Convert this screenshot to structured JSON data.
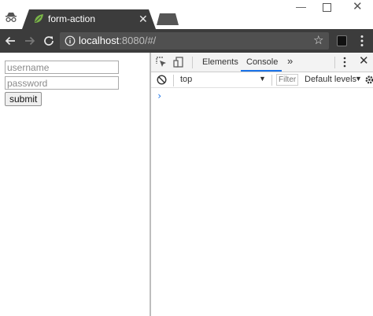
{
  "browser": {
    "tab": {
      "title": "form-action"
    },
    "address_bar": {
      "host": "localhost",
      "rest": ":8080/#/"
    }
  },
  "page": {
    "username_placeholder": "username",
    "password_placeholder": "password",
    "submit_label": "submit"
  },
  "devtools": {
    "tabs": [
      "Elements",
      "Console"
    ],
    "more_tabs": "»",
    "active_tab": "Console",
    "context": "top",
    "filter_placeholder": "Filter",
    "levels": "Default levels",
    "prompt": "›"
  },
  "colors": {
    "chrome_dark": "#3c3c3c",
    "omnibox": "#505050",
    "accent": "#1a73e8",
    "favicon": "#7ab648"
  },
  "icons": {
    "incognito": "incognito-icon",
    "favicon": "leaf-icon",
    "back": "arrow-left-icon",
    "forward": "arrow-right-icon",
    "reload": "reload-icon",
    "info": "info-icon",
    "bookmark": "star-icon",
    "extension": "extension-icon",
    "menu": "kebab-menu-icon",
    "inspect": "inspect-element-icon",
    "device": "device-toolbar-icon",
    "clear": "clear-console-icon",
    "settings": "gear-icon"
  }
}
